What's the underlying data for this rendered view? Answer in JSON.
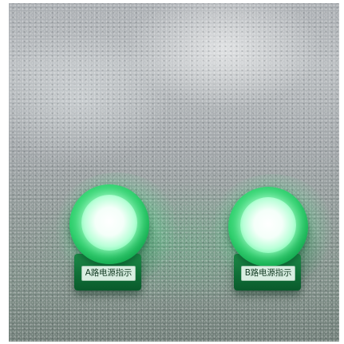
{
  "scene": {
    "description_colors": {
      "panel": "#a9adb1",
      "indicator_green": "#2fcf6d",
      "lens_white": "#f4fff9",
      "label_bg": "#d9eee2"
    }
  },
  "indicators": [
    {
      "label": "A路电源指示",
      "state": "on"
    },
    {
      "label": "B路电源指示",
      "state": "on"
    }
  ]
}
